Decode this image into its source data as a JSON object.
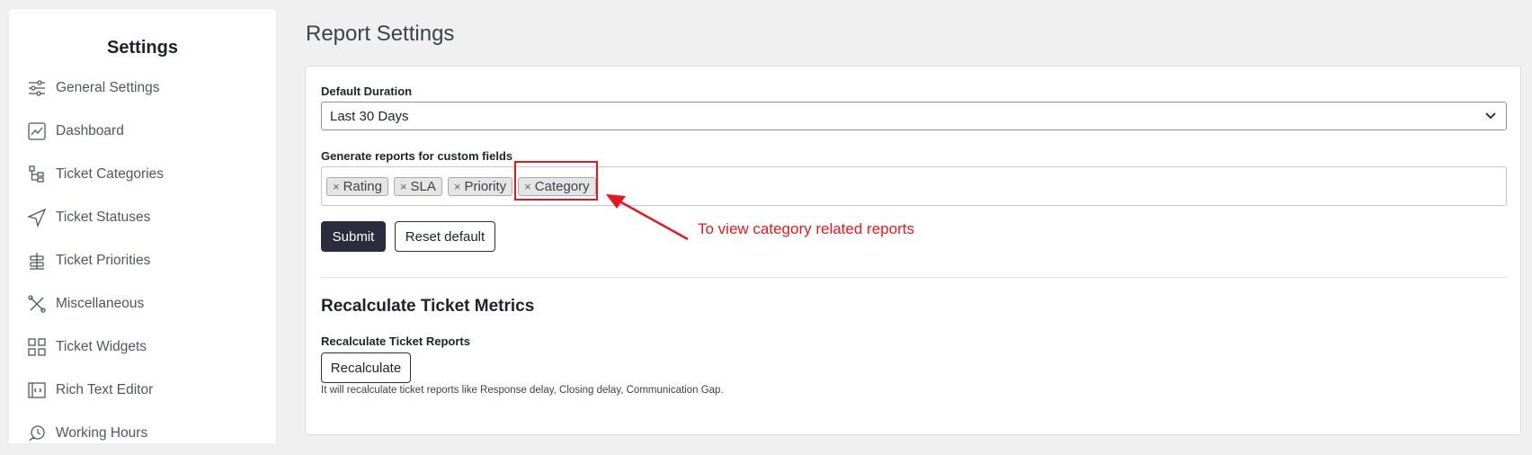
{
  "sidebar": {
    "title": "Settings",
    "items": [
      {
        "label": "General Settings",
        "icon": "sliders-icon"
      },
      {
        "label": "Dashboard",
        "icon": "chart-icon"
      },
      {
        "label": "Ticket Categories",
        "icon": "category-tree-icon"
      },
      {
        "label": "Ticket Statuses",
        "icon": "send-icon"
      },
      {
        "label": "Ticket Priorities",
        "icon": "priority-icon"
      },
      {
        "label": "Miscellaneous",
        "icon": "tools-icon"
      },
      {
        "label": "Ticket Widgets",
        "icon": "widgets-icon"
      },
      {
        "label": "Rich Text Editor",
        "icon": "code-window-icon"
      },
      {
        "label": "Working Hours",
        "icon": "clock-icon"
      }
    ]
  },
  "main": {
    "title": "Report Settings",
    "default_duration": {
      "label": "Default Duration",
      "value": "Last 30 Days"
    },
    "custom_fields": {
      "label": "Generate reports for custom fields",
      "tags": [
        "Rating",
        "SLA",
        "Priority",
        "Category"
      ],
      "remove_symbol": "×"
    },
    "submit_label": "Submit",
    "reset_label": "Reset default",
    "recalc": {
      "section_title": "Recalculate Ticket Metrics",
      "label": "Recalculate Ticket Reports",
      "button_label": "Recalculate",
      "help_text": "It will recalculate ticket reports like Response delay, Closing delay, Communication Gap."
    }
  },
  "annotation": {
    "text": "To view category related reports",
    "color": "#e5181d"
  },
  "colors": {
    "primary_button": "#2c2c3e",
    "background": "#f0f0f1"
  }
}
